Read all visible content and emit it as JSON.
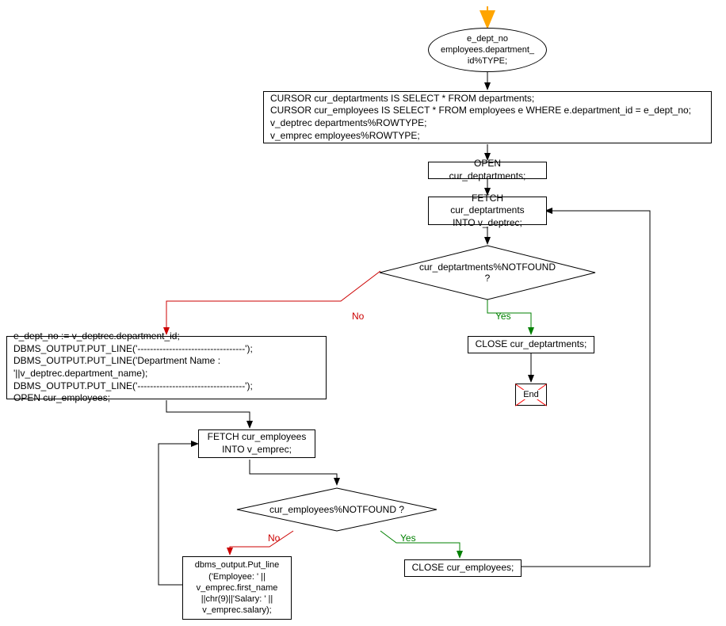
{
  "flowchart": {
    "nodes": {
      "start_ellipse": {
        "line1": "e_dept_no",
        "line2": "employees.department_",
        "line3": "id%TYPE;"
      },
      "cursors_box": {
        "line1": "CURSOR cur_deptartments IS SELECT * FROM departments;",
        "line2": "CURSOR cur_employees IS SELECT * FROM employees e WHERE  e.department_id = e_dept_no;",
        "line3": "v_deptrec departments%ROWTYPE;",
        "line4": "v_emprec  employees%ROWTYPE;"
      },
      "open_dept": "OPEN cur_deptartments;",
      "fetch_dept": {
        "line1": "FETCH cur_deptartments",
        "line2": "INTO v_deptrec;"
      },
      "dept_notfound": {
        "line1": "cur_deptartments%NOTFOUND",
        "line2": "?"
      },
      "close_dept": "CLOSE cur_deptartments;",
      "end": "End",
      "dept_body": {
        "line1": "e_dept_no := v_deptrec.department_id;",
        "line2": "DBMS_OUTPUT.PUT_LINE('----------------------------------');",
        "line3": "DBMS_OUTPUT.PUT_LINE('Department Name : '||v_deptrec.department_name);",
        "line4": "DBMS_OUTPUT.PUT_LINE('----------------------------------');",
        "line5": "OPEN cur_employees;"
      },
      "fetch_emp": {
        "line1": "FETCH cur_employees",
        "line2": "INTO v_emprec;"
      },
      "emp_notfound": "cur_employees%NOTFOUND ?",
      "close_emp": "CLOSE cur_employees;",
      "put_line_emp": {
        "line1": "dbms_output.Put_line",
        "line2": "('Employee: ' ||",
        "line3": "v_emprec.first_name",
        "line4": "||chr(9)||'Salary: ' ||",
        "line5": "v_emprec.salary);"
      }
    },
    "edges": {
      "yes": "Yes",
      "no": "No"
    }
  }
}
